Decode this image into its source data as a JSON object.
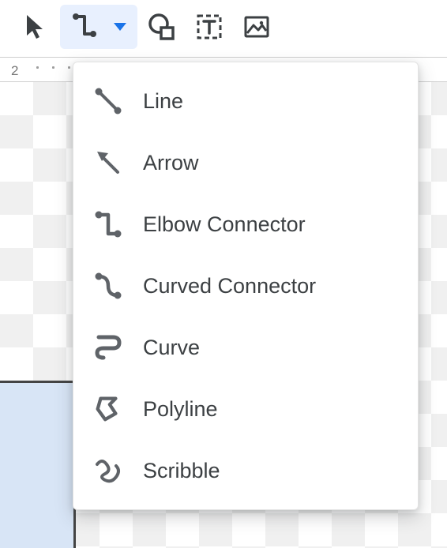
{
  "toolbar": {
    "select_tool": "Select",
    "line_tool": "Line",
    "line_dropdown": "Line options",
    "shape_tool": "Shape",
    "text_box_tool": "Text box",
    "image_tool": "Insert image"
  },
  "ruler": {
    "label": "2"
  },
  "menu": {
    "items": [
      {
        "label": "Line"
      },
      {
        "label": "Arrow"
      },
      {
        "label": "Elbow Connector"
      },
      {
        "label": "Curved Connector"
      },
      {
        "label": "Curve"
      },
      {
        "label": "Polyline"
      },
      {
        "label": "Scribble"
      }
    ]
  }
}
